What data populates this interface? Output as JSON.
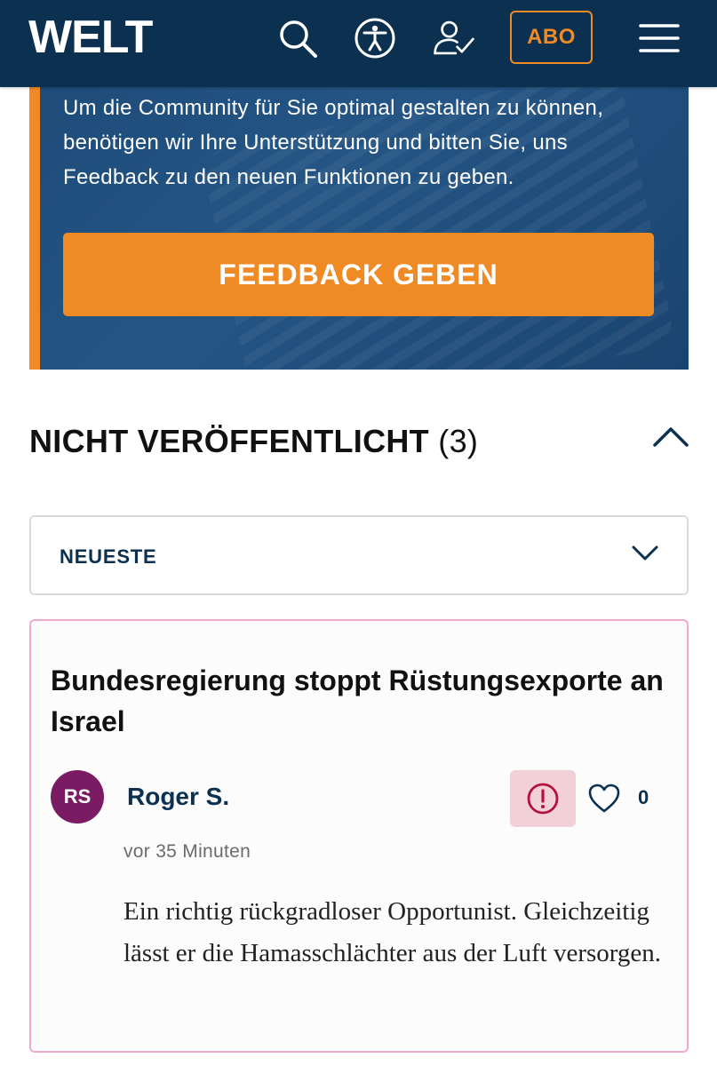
{
  "header": {
    "logo": "WELT",
    "subscribe_label": "ABO",
    "icons": [
      "search-icon",
      "accessibility-icon",
      "login-icon",
      "menu-icon"
    ]
  },
  "banner": {
    "text": "Um die Community für Sie optimal gestalten zu können, benötigen wir Ihre Unterstützung und bitten Sie, uns Feedback zu den neuen Funktionen zu geben.",
    "button_label": "FEEDBACK GEBEN"
  },
  "section": {
    "title": "NICHT VERÖFFENTLICHT",
    "count": "(3)"
  },
  "sort": {
    "selected": "NEUESTE"
  },
  "comment": {
    "article_title": "Bundesregierung stoppt Rüstungsexporte an Israel",
    "avatar_initials": "RS",
    "author": "Roger S.",
    "time": "vor 35 Minuten",
    "likes": "0",
    "text": "Ein richtig rückgradloser Opportunist. Gleichzeitig lässt er die Hamasschlächter aus der Luft versorgen."
  },
  "colors": {
    "header_bg": "#0b3050",
    "accent": "#f08a24",
    "avatar": "#7b1b63",
    "card_border": "#f3a8cf"
  }
}
